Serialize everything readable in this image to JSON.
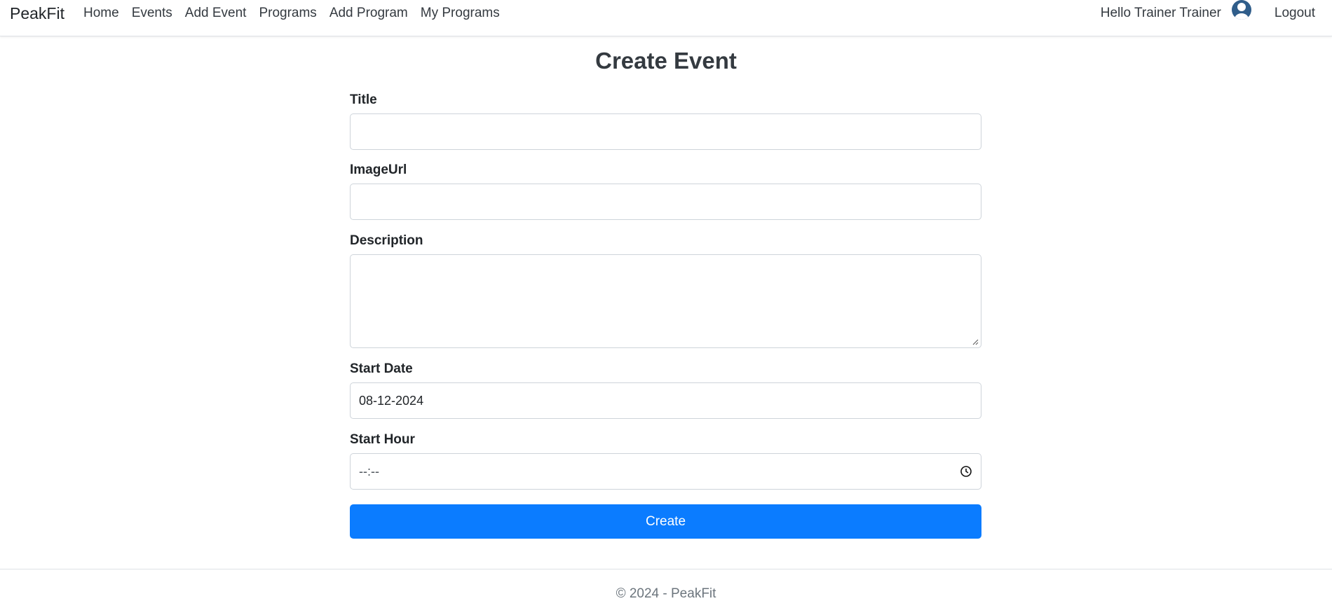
{
  "navbar": {
    "brand": "PeakFit",
    "links": [
      "Home",
      "Events",
      "Add Event",
      "Programs",
      "Add Program",
      "My Programs"
    ],
    "greeting": "Hello Trainer Trainer",
    "logout": "Logout",
    "avatar_icon": "user-avatar-icon"
  },
  "main": {
    "title": "Create Event",
    "fields": {
      "title_label": "Title",
      "title_value": "",
      "image_label": "ImageUrl",
      "image_value": "",
      "description_label": "Description",
      "description_value": "",
      "start_date_label": "Start Date",
      "start_date_value": "08-12-2024",
      "start_hour_label": "Start Hour",
      "start_hour_value": "--:--"
    },
    "submit_label": "Create"
  },
  "footer": {
    "text": "© 2024 - PeakFit"
  },
  "colors": {
    "primary": "#0b7cff",
    "avatar": "#2f5d8a"
  }
}
